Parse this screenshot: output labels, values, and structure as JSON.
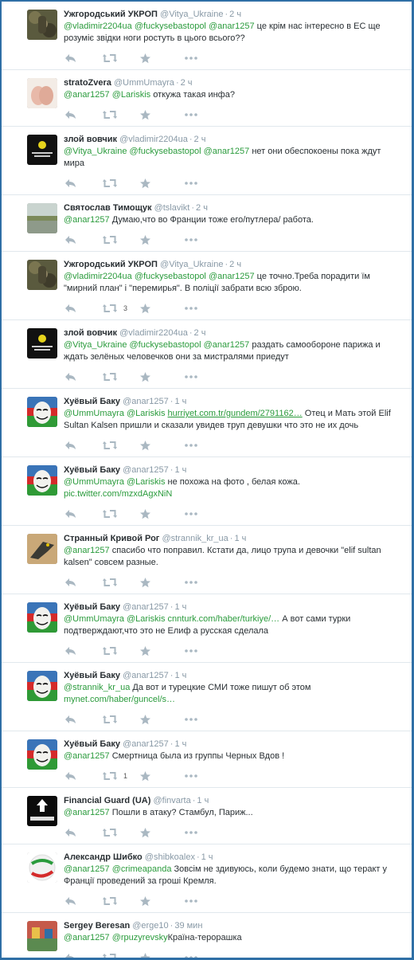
{
  "colors": {
    "accent": "#2a9b3c",
    "frame": "#2f6fa6",
    "muted": "#8899a6"
  },
  "tweets": [
    {
      "name": "Ужгородський УКРОП",
      "handle": "@Vitya_Ukraine",
      "time": "2 ч",
      "avatar": "camo",
      "parts": [
        {
          "t": "m",
          "v": "@vladimir2204ua"
        },
        {
          "t": "s",
          "v": " "
        },
        {
          "t": "m",
          "v": "@fuckysebastopol"
        },
        {
          "t": "s",
          "v": " "
        },
        {
          "t": "m",
          "v": "@anar1257"
        },
        {
          "t": "s",
          "v": " це крім нас інтересно в ЕС ще розуміє звідки ноги ростуть в цього всього??"
        }
      ],
      "retweets": ""
    },
    {
      "name": "stratoZvera",
      "handle": "@UmmUmayra",
      "time": "2 ч",
      "avatar": "hands",
      "parts": [
        {
          "t": "m",
          "v": "@anar1257"
        },
        {
          "t": "s",
          "v": " "
        },
        {
          "t": "m",
          "v": "@Lariskis"
        },
        {
          "t": "s",
          "v": " откужа такая инфа?"
        }
      ],
      "retweets": ""
    },
    {
      "name": "злой вовчик",
      "handle": "@vladimir2204ua",
      "time": "2 ч",
      "avatar": "black",
      "parts": [
        {
          "t": "m",
          "v": "@Vitya_Ukraine"
        },
        {
          "t": "s",
          "v": " "
        },
        {
          "t": "m",
          "v": "@fuckysebastopol"
        },
        {
          "t": "s",
          "v": " "
        },
        {
          "t": "m",
          "v": "@anar1257"
        },
        {
          "t": "s",
          "v": " нет они  обеспокоены  пока  ждут  мира"
        }
      ],
      "retweets": ""
    },
    {
      "name": "Святослав Тимощук",
      "handle": "@tslavikt",
      "time": "2 ч",
      "avatar": "lake",
      "parts": [
        {
          "t": "m",
          "v": "@anar1257"
        },
        {
          "t": "s",
          "v": " Думаю,что во Франции тоже его/путлера/ работа."
        }
      ],
      "retweets": ""
    },
    {
      "name": "Ужгородський УКРОП",
      "handle": "@Vitya_Ukraine",
      "time": "2 ч",
      "avatar": "camo",
      "parts": [
        {
          "t": "m",
          "v": "@vladimir2204ua"
        },
        {
          "t": "s",
          "v": " "
        },
        {
          "t": "m",
          "v": "@fuckysebastopol"
        },
        {
          "t": "s",
          "v": " "
        },
        {
          "t": "m",
          "v": "@anar1257"
        },
        {
          "t": "s",
          "v": " це точно.Треба порадити їм \"мирний план\" і \"перемирья\". В поліції забрати всю зброю."
        }
      ],
      "retweets": "3"
    },
    {
      "name": "злой вовчик",
      "handle": "@vladimir2204ua",
      "time": "2 ч",
      "avatar": "black",
      "parts": [
        {
          "t": "m",
          "v": "@Vitya_Ukraine"
        },
        {
          "t": "s",
          "v": " "
        },
        {
          "t": "m",
          "v": "@fuckysebastopol"
        },
        {
          "t": "s",
          "v": " "
        },
        {
          "t": "m",
          "v": "@anar1257"
        },
        {
          "t": "s",
          "v": " раздать  самообороне парижа и  ждать  зелёных  человечков они  за  мистралями  приедут"
        }
      ],
      "retweets": ""
    },
    {
      "name": "Хуёвый Баку",
      "handle": "@anar1257",
      "time": "1 ч",
      "avatar": "mask",
      "parts": [
        {
          "t": "m",
          "v": "@UmmUmayra"
        },
        {
          "t": "s",
          "v": " "
        },
        {
          "t": "m",
          "v": "@Lariskis"
        },
        {
          "t": "s",
          "v": " "
        },
        {
          "t": "u",
          "v": "hurriyet.com.tr/gundem/2791162…"
        },
        {
          "t": "s",
          "v": " Отец и Мать этой Elif Sultan Kalsen пришли и сказали увидев труп девушки что это не их дочь"
        }
      ],
      "retweets": ""
    },
    {
      "name": "Хуёвый Баку",
      "handle": "@anar1257",
      "time": "1 ч",
      "avatar": "mask",
      "parts": [
        {
          "t": "m",
          "v": "@UmmUmayra"
        },
        {
          "t": "s",
          "v": " "
        },
        {
          "t": "m",
          "v": "@Lariskis"
        },
        {
          "t": "s",
          "v": "  не похожа на фото , белая кожа. "
        },
        {
          "t": "l",
          "v": "pic.twitter.com/mzxdAgxNiN"
        }
      ],
      "retweets": ""
    },
    {
      "name": "Странный Кривой Рог",
      "handle": "@strannik_kr_ua",
      "time": "1 ч",
      "avatar": "bird",
      "parts": [
        {
          "t": "m",
          "v": "@anar1257"
        },
        {
          "t": "s",
          "v": " спасибо что поправил. Кстати да, лицо трупа и девочки \"elif sultan kalsen\" совсем разные."
        }
      ],
      "retweets": ""
    },
    {
      "name": "Хуёвый Баку",
      "handle": "@anar1257",
      "time": "1 ч",
      "avatar": "mask",
      "parts": [
        {
          "t": "m",
          "v": "@UmmUmayra"
        },
        {
          "t": "s",
          "v": " "
        },
        {
          "t": "m",
          "v": "@Lariskis"
        },
        {
          "t": "s",
          "v": " "
        },
        {
          "t": "l",
          "v": "cnnturk.com/haber/turkiye/…"
        },
        {
          "t": "s",
          "v": " А вот сами турки подтверждают,что это не Елиф а русская сделала"
        }
      ],
      "retweets": ""
    },
    {
      "name": "Хуёвый Баку",
      "handle": "@anar1257",
      "time": "1 ч",
      "avatar": "mask",
      "parts": [
        {
          "t": "m",
          "v": "@strannik_kr_ua"
        },
        {
          "t": "s",
          "v": " Да вот и турецкие СМИ тоже пишут об этом "
        },
        {
          "t": "l",
          "v": "mynet.com/haber/guncel/s…"
        }
      ],
      "retweets": ""
    },
    {
      "name": "Хуёвый Баку",
      "handle": "@anar1257",
      "time": "1 ч",
      "avatar": "mask",
      "parts": [
        {
          "t": "m",
          "v": "@anar1257"
        },
        {
          "t": "s",
          "v": " Смертница была из группы Черных Вдов !"
        }
      ],
      "retweets": "1"
    },
    {
      "name": "Financial Guard (UA)",
      "handle": "@finvarta",
      "time": "1 ч",
      "avatar": "finvarta",
      "parts": [
        {
          "t": "m",
          "v": "@anar1257"
        },
        {
          "t": "s",
          "v": " Пошли в атаку? Стамбул, Париж..."
        }
      ],
      "retweets": ""
    },
    {
      "name": "Александр Шибко",
      "handle": "@shibkoalex",
      "time": "1 ч",
      "avatar": "ball",
      "parts": [
        {
          "t": "m",
          "v": "@anar1257"
        },
        {
          "t": "s",
          "v": " "
        },
        {
          "t": "m",
          "v": "@crimeapanda"
        },
        {
          "t": "s",
          "v": " Зовсім не здивуюсь, коли будемо знати, що теракт у Франції проведений за гроші Кремля."
        }
      ],
      "retweets": ""
    },
    {
      "name": "Sergey Beresan",
      "handle": "@erge10",
      "time": "39 мин",
      "avatar": "street",
      "parts": [
        {
          "t": "m",
          "v": "@anar1257"
        },
        {
          "t": "s",
          "v": " "
        },
        {
          "t": "m",
          "v": "@rpuzyrevsky"
        },
        {
          "t": "s",
          "v": "Країна-терроραшка"
        }
      ],
      "retweets": ""
    }
  ]
}
